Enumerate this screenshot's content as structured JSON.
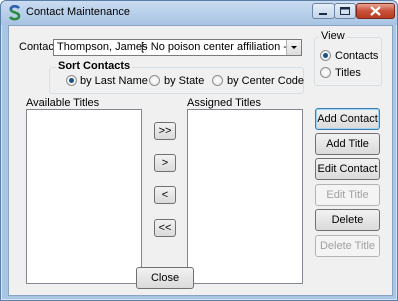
{
  "window": {
    "title": "Contact Maintenance"
  },
  "contact": {
    "label": "Contact:",
    "selected_name": "Thompson, James",
    "selected_affiliation": "[- No poison center affiliation -]"
  },
  "sort": {
    "group_label": "Sort Contacts",
    "options": [
      "by Last Name",
      "by State",
      "by Center Code"
    ],
    "selected": "by Last Name"
  },
  "view": {
    "group_label": "View",
    "options": [
      "Contacts",
      "Titles"
    ],
    "selected": "Contacts"
  },
  "lists": {
    "available_label": "Available Titles",
    "assigned_label": "Assigned Titles",
    "available_items": [],
    "assigned_items": []
  },
  "move_buttons": {
    "add_all": ">>",
    "add_one": ">",
    "remove_one": "<",
    "remove_all": "<<"
  },
  "actions": {
    "add_contact": "Add Contact",
    "add_title": "Add Title",
    "edit_contact": "Edit Contact",
    "edit_title": "Edit Title",
    "delete_contact": "Delete Contact",
    "delete_title": "Delete Title",
    "close": "Close"
  },
  "icons": {
    "app": "app-s-icon",
    "minimize": "minimize-icon",
    "maximize": "maximize-icon",
    "close": "close-icon",
    "dropdown": "chevron-down-icon"
  },
  "colors": {
    "title_bar": "#a9c6e5",
    "close_button": "#c9513a",
    "dialog_bg": "#f0f0f0",
    "disabled_text": "#a0a0a0"
  }
}
